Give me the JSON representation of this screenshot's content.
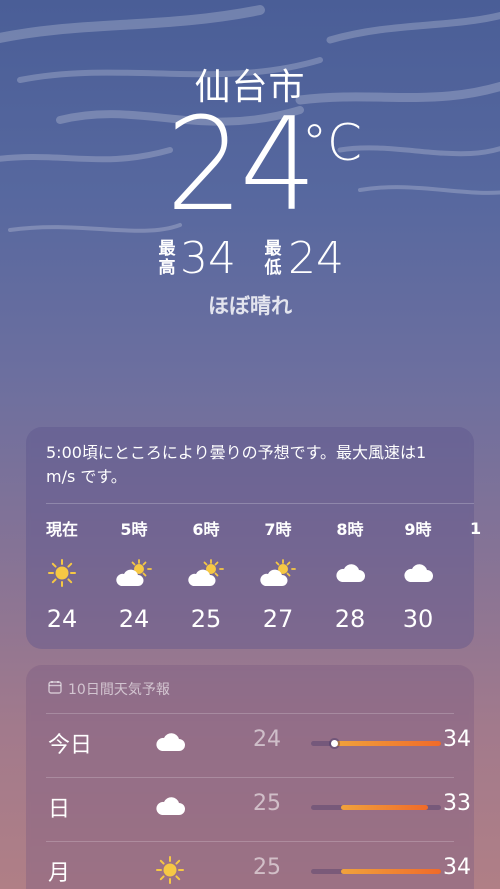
{
  "location": {
    "city": "仙台市"
  },
  "current": {
    "temperature": "24",
    "unit": "°C",
    "high_label_1": "最",
    "high_label_2": "高",
    "high": "34",
    "low_label_1": "最",
    "low_label_2": "低",
    "low": "24",
    "condition": "ほぼ晴れ"
  },
  "hourly": {
    "summary": "5:00頃にところにより曇りの予想です。最大風速は1 m/s です。",
    "items": [
      {
        "time": "現在",
        "icon": "sun-icon",
        "temp": "24"
      },
      {
        "time": "5時",
        "icon": "partly-cloudy-icon",
        "temp": "24"
      },
      {
        "time": "6時",
        "icon": "partly-cloudy-icon",
        "temp": "25"
      },
      {
        "time": "7時",
        "icon": "partly-cloudy-icon",
        "temp": "27"
      },
      {
        "time": "8時",
        "icon": "cloud-icon",
        "temp": "28"
      },
      {
        "time": "9時",
        "icon": "cloud-icon",
        "temp": "30"
      }
    ],
    "more_label": "1"
  },
  "daily": {
    "header": "10日間天気予報",
    "header_icon": "calendar-icon",
    "items": [
      {
        "day": "今日",
        "icon": "cloud-icon",
        "low": "24",
        "high": "34",
        "range_start": 0.18,
        "range_end": 1.0,
        "current_marker": 0.18
      },
      {
        "day": "日",
        "icon": "cloud-icon",
        "low": "25",
        "high": "33",
        "range_start": 0.23,
        "range_end": 0.9
      },
      {
        "day": "月",
        "icon": "sun-icon",
        "low": "25",
        "high": "34",
        "range_start": 0.23,
        "range_end": 1.0
      }
    ]
  },
  "colors": {
    "sky_top": "#4a5e97",
    "sky_bottom": "#b07f86",
    "sun": "#f6c844",
    "bar_warm": "#f06a2a"
  }
}
